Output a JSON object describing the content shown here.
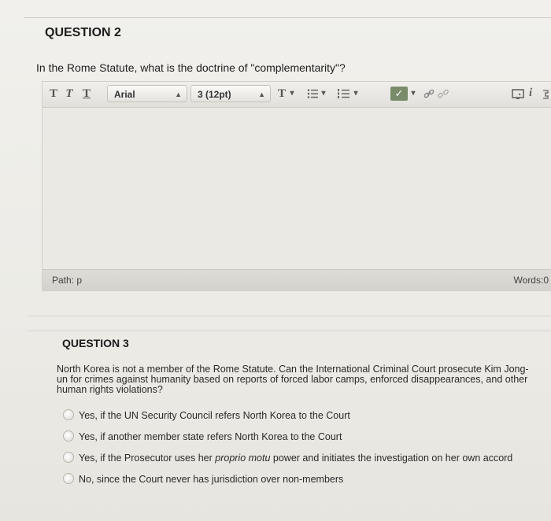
{
  "question2": {
    "title": "QUESTION 2",
    "prompt": "In the Rome Statute, what is the doctrine of \"complementarity\"?"
  },
  "editor": {
    "toolbar": {
      "bold_glyph": "T",
      "italic_glyph": "T",
      "underline_glyph": "T",
      "font_family": "Arial",
      "font_size": "3 (12pt)",
      "text_color_glyph": "T",
      "dropdown_glyph": "▾"
    },
    "path_label": "Path: p",
    "word_count": "Words:0"
  },
  "question3": {
    "title": "QUESTION 3",
    "prompt": "North Korea is not a member of the Rome Statute. Can the International Criminal Court prosecute Kim Jong-un for crimes against humanity based on reports of forced labor camps, enforced disappearances, and other human rights violations?",
    "options": [
      {
        "text": "Yes, if the UN Security Council refers North Korea to the Court"
      },
      {
        "text": "Yes, if another member state refers North Korea to the Court"
      },
      {
        "pre": "Yes, if the Prosecutor uses her ",
        "em": "proprio motu",
        "post": " power and initiates the investigation on her own accord"
      },
      {
        "text": "No, since the Court never has jurisdiction over non-members"
      }
    ]
  }
}
